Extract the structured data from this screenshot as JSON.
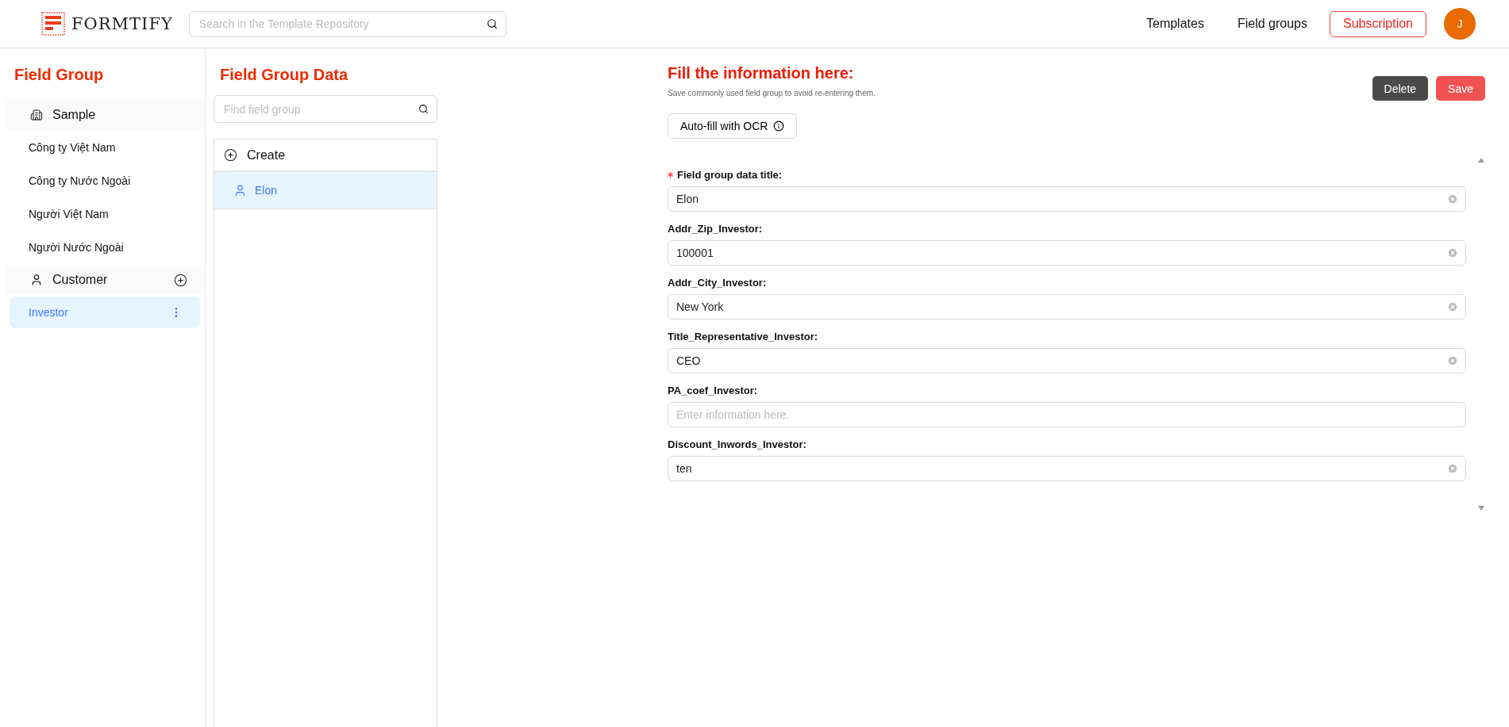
{
  "header": {
    "logo": "FORMTIFY",
    "search": {
      "placeholder": "Search in the Template Repository"
    },
    "nav": [
      "Templates",
      "Field groups"
    ],
    "subscription": "Subscription",
    "avatar": "J"
  },
  "sidebar": {
    "title": "Field Group",
    "groups": [
      {
        "label": "Sample",
        "kind": "sample",
        "items": [
          {
            "label": "Công ty Việt Nam",
            "selected": false
          },
          {
            "label": "Công ty Nước Ngoài",
            "selected": false
          },
          {
            "label": "Người Việt Nam",
            "selected": false
          },
          {
            "label": "Người Nước Ngoài",
            "selected": false
          }
        ]
      },
      {
        "label": "Customer",
        "kind": "custom",
        "items": [
          {
            "label": "Investor",
            "selected": true
          }
        ]
      }
    ]
  },
  "data_panel": {
    "title": "Field Group Data",
    "search": {
      "placeholder": "Find field group"
    },
    "create": "Create",
    "items": [
      {
        "label": "Elon",
        "selected": true
      }
    ]
  },
  "form": {
    "title": "Fill the information here:",
    "subtitle": "Save commonly used field group to avoid re-entering them.",
    "ocr_button": "Auto-fill with OCR",
    "delete": "Delete",
    "save": "Save",
    "fields": [
      {
        "label": "Field group data title:",
        "required": true,
        "value": "Elon"
      },
      {
        "label": "Addr_Zip_Investor:",
        "required": false,
        "value": "100001"
      },
      {
        "label": "Addr_City_Investor:",
        "required": false,
        "value": "New York"
      },
      {
        "label": "Title_Representative_Investor:",
        "required": false,
        "value": "CEO"
      },
      {
        "label": "PA_coef_Investor:",
        "required": false,
        "placeholder": "Enter information here."
      },
      {
        "label": "Discount_Inwords_Investor:",
        "required": false,
        "value": "ten"
      }
    ]
  }
}
